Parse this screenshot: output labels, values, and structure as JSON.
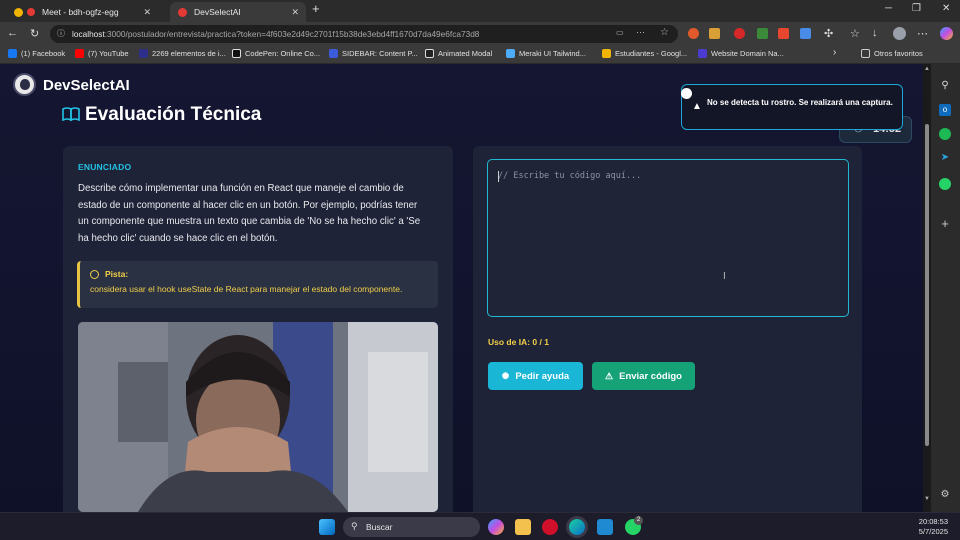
{
  "browser": {
    "tabs": [
      {
        "label": "Meet - bdh-ogfz-egg",
        "active": false
      },
      {
        "label": "DevSelectAI",
        "active": true
      }
    ],
    "url_host": "localhost",
    "url_rest": ":3000/postulador/entrevista/practica?token=4f603e2d49c2701f15b38de3ebd4ff1670d7da49e6fca73d8",
    "bookmarks": [
      "(1) Facebook",
      "(7) YouTube",
      "2269 elementos de i...",
      "CodePen: Online Co...",
      "SIDEBAR: Content P...",
      "Animated Modal",
      "Meraki UI Tailwind...",
      "Estudiantes - Googl...",
      "Website Domain Na...",
      "Otros favoritos"
    ]
  },
  "app": {
    "brand": "DevSelectAI",
    "page_title": "Evaluación Técnica",
    "timer": "14:52"
  },
  "question": {
    "heading": "ENUNCIADO",
    "text": "Describe cómo implementar una función en React que maneje el cambio de estado de un componente al hacer clic en un botón. Por ejemplo, podrías tener un componente que muestra un texto que cambia de 'No se ha hecho clic' a 'Se ha hecho clic' cuando se hace clic en el botón.",
    "hint_title": "Pista:",
    "hint_text": "considera usar el hook useState de React para manejar el estado del componente."
  },
  "editor": {
    "placeholder": "// Escribe tu código aquí..."
  },
  "ai_usage": "Uso de IA: 0 / 1",
  "buttons": {
    "help": "Pedir ayuda",
    "send": "Enviar código"
  },
  "toast": {
    "message": "No se detecta tu rostro. Se realizará una captura."
  },
  "taskbar": {
    "search": "Buscar",
    "time": "20:08:53",
    "date": "5/7/2025",
    "whatsapp_badge": "2"
  },
  "colors": {
    "accent_cyan": "#19b6d6",
    "accent_green": "#15a277",
    "hint_yellow": "#f2cf4a",
    "page_bg": "#141631"
  }
}
